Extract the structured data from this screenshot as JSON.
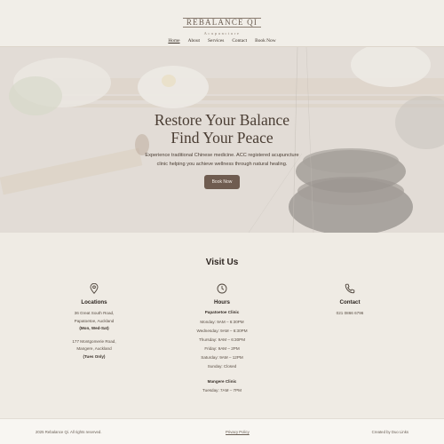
{
  "brand": {
    "name": "REBALANCE QI",
    "tagline": "Acupuncture"
  },
  "nav": [
    {
      "label": "Home",
      "active": true
    },
    {
      "label": "About",
      "active": false
    },
    {
      "label": "Services",
      "active": false
    },
    {
      "label": "Contact",
      "active": false
    },
    {
      "label": "Book Now",
      "active": false
    }
  ],
  "hero": {
    "title_line1": "Restore Your Balance",
    "title_line2": "Find Your Peace",
    "text_line1": "Experience traditional Chinese medicine. ACC registered acupuncture",
    "text_line2": "clinic helping you achieve wellness through natural healing.",
    "button": "Book Now"
  },
  "visit": {
    "title": "Visit Us",
    "locations": {
      "heading": "Locations",
      "addr1_line1": "36 Great South Road,",
      "addr1_line2": "Papatoetoe, Auckland",
      "addr1_note": "(Mon, Wed-Sat)",
      "addr2_line1": "177 Montgomerie Road,",
      "addr2_line2": "Mangere, Auckland",
      "addr2_note": "(Tues Only)"
    },
    "hours": {
      "heading": "Hours",
      "clinic1": "Papatoetoe Clinic",
      "clinic1_hours": [
        "Monday: 9AM – 6:30PM",
        "Wednesday: 9AM – 6:30PM",
        "Thursday: 9AM – 6:30PM",
        "Friday: 9AM – 2PM",
        "Saturday: 9AM – 12PM",
        "Sunday: Closed"
      ],
      "clinic2": "Mangere Clinic",
      "clinic2_hours": [
        "Tuesday: 7AM – 7PM"
      ]
    },
    "contact": {
      "heading": "Contact",
      "phone": "021 0866 6796"
    }
  },
  "footer": {
    "copyright": "2025 Rebalance Qi. All rights reserved.",
    "privacy": "Privacy Policy",
    "credit": "Created by Duo Links"
  }
}
